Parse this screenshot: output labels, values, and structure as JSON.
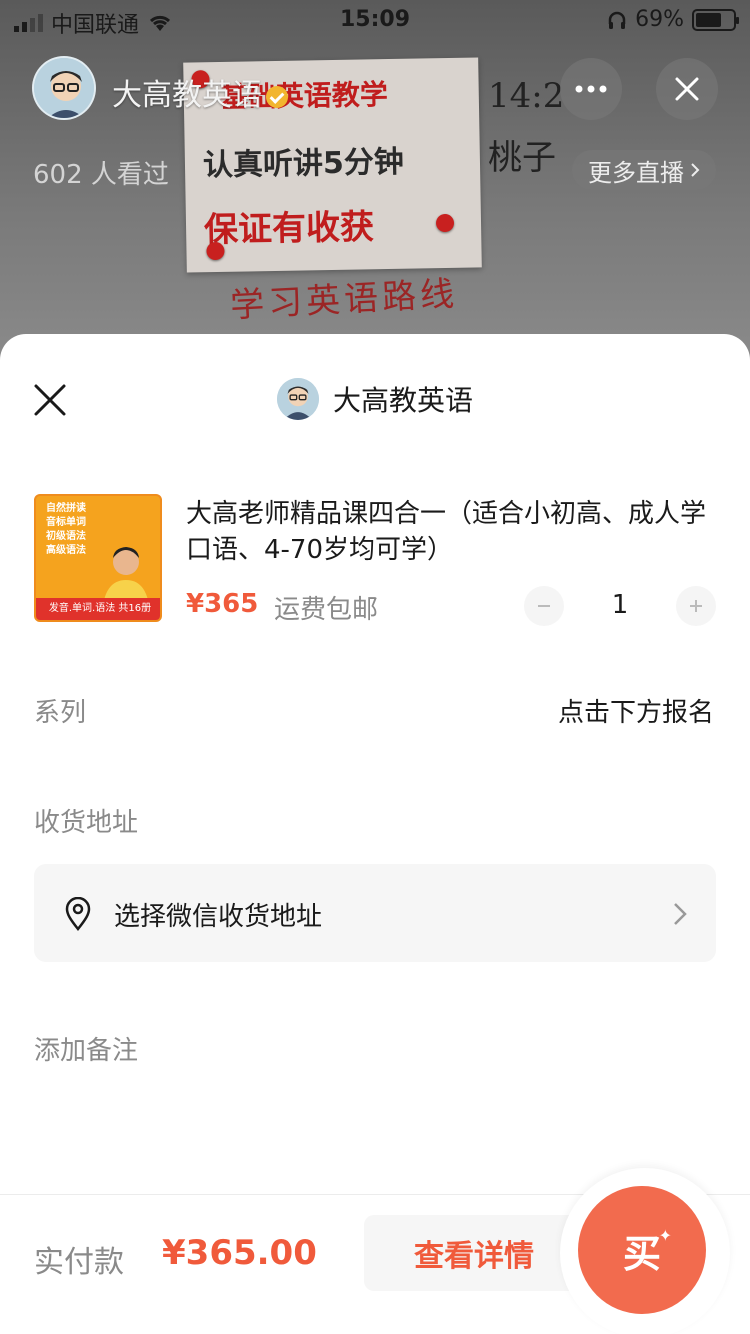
{
  "status_bar": {
    "carrier": "中国联通",
    "time": "15:09",
    "battery_text": "69%",
    "battery_level": 0.69
  },
  "live_room": {
    "host_name": "大高教英语",
    "viewers": "602 人看过",
    "more_live_label": "更多直播",
    "note_lines": [
      "基础英语教学",
      "认真听讲5分钟",
      "保证有收获"
    ],
    "handwriting": "学习英语路线",
    "hand_right_1": "14:2",
    "hand_right_2": "桃子"
  },
  "sheet": {
    "shop_name": "大高教英语",
    "product": {
      "title": "大高老师精品课四合一（适合小初高、成人学口语、4-70岁均可学）",
      "price": "¥365",
      "shipping": "运费包邮",
      "quantity": "1",
      "cover_lines": [
        "自然拼读",
        "音标单词",
        "初级语法",
        "高级语法"
      ],
      "cover_strip": "发音.单词.语法 共16册"
    },
    "series_label": "系列",
    "series_value": "点击下方报名",
    "address_label": "收货地址",
    "address_placeholder": "选择微信收货地址",
    "note_label": "添加备注"
  },
  "bottom_bar": {
    "pay_label": "实付款",
    "pay_amount": "¥365.00",
    "detail_button": "查看详情",
    "buy_button": "买"
  },
  "colors": {
    "accent": "#f05a3b",
    "buy_button": "#f26b4e",
    "muted_text": "#8a8a8a"
  }
}
